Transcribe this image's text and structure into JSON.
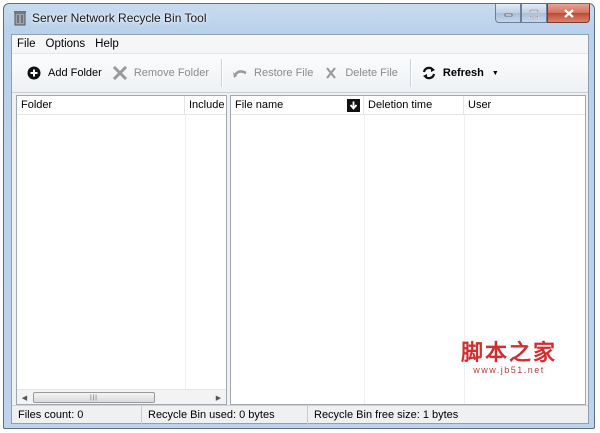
{
  "window": {
    "title": "Server Network Recycle Bin Tool",
    "icon": "recycle-bin-app-icon",
    "caption_buttons": [
      "minimize",
      "maximize",
      "close"
    ]
  },
  "menu": {
    "items": [
      "File",
      "Options",
      "Help"
    ]
  },
  "toolbar": {
    "add_folder": "Add Folder",
    "remove_folder": "Remove Folder",
    "restore_file": "Restore File",
    "delete_file": "Delete File",
    "refresh": "Refresh",
    "disabled": [
      "Remove Folder",
      "Restore File",
      "Delete File"
    ]
  },
  "folder_list": {
    "columns": [
      "Folder",
      "Include"
    ],
    "rows": []
  },
  "file_list": {
    "columns": [
      "File name",
      "Deletion time",
      "User"
    ],
    "sort_column": "File name",
    "sort_icon": "sort-down-arrow-icon",
    "rows": []
  },
  "status": {
    "files_count": "Files count: 0",
    "used": "Recycle Bin used: 0 bytes",
    "free": "Recycle Bin free size: 1 bytes"
  },
  "watermark": {
    "text": "脚本之家",
    "url": "www.jb51.net"
  },
  "colors": {
    "accent_title": "#b9d1ea",
    "close_button": "#c04a30",
    "watermark": "#d12f2f",
    "disabled_text": "#8b8b8b"
  }
}
